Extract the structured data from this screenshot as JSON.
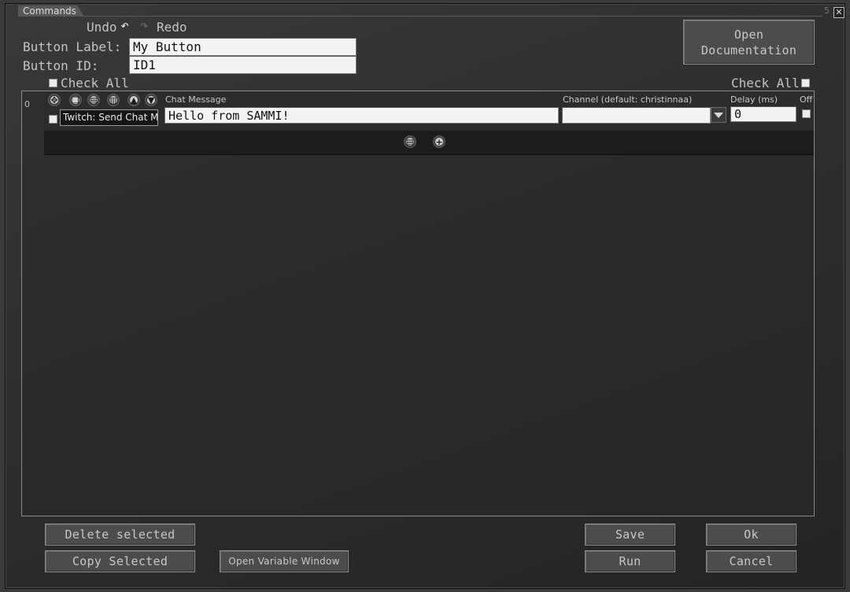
{
  "window": {
    "title": "Commands",
    "close_glyph": "✕",
    "corner_mark": "5"
  },
  "toolbar": {
    "undo_label": "Undo",
    "redo_label": "Redo",
    "undo_icon": "↶",
    "redo_icon": "↷"
  },
  "form": {
    "button_label_caption": "Button Label:",
    "button_label_value": "My Button",
    "button_id_caption": "Button ID:",
    "button_id_value": "ID1"
  },
  "check_all_left": "Check All",
  "check_all_right": "Check All",
  "open_documentation": {
    "line1": "Open",
    "line2": "Documentation"
  },
  "command_row": {
    "index": "0",
    "command_type": "Twitch: Send Chat Me",
    "chat_message_label": "Chat Message",
    "chat_message_value": "Hello from SAMMI!",
    "channel_label": "Channel (default: christinnaa)",
    "channel_value": "",
    "delay_label": "Delay (ms)",
    "delay_value": "0",
    "off_label": "Off",
    "icons": [
      "move-icon",
      "copy-icon",
      "paste-icon",
      "delete-icon",
      "move-up-icon",
      "move-down-icon"
    ]
  },
  "footer_buttons": {
    "delete_selected": "Delete selected",
    "copy_selected": "Copy Selected",
    "open_variable_window": "Open Variable Window",
    "save": "Save",
    "run": "Run",
    "ok": "Ok",
    "cancel": "Cancel"
  }
}
